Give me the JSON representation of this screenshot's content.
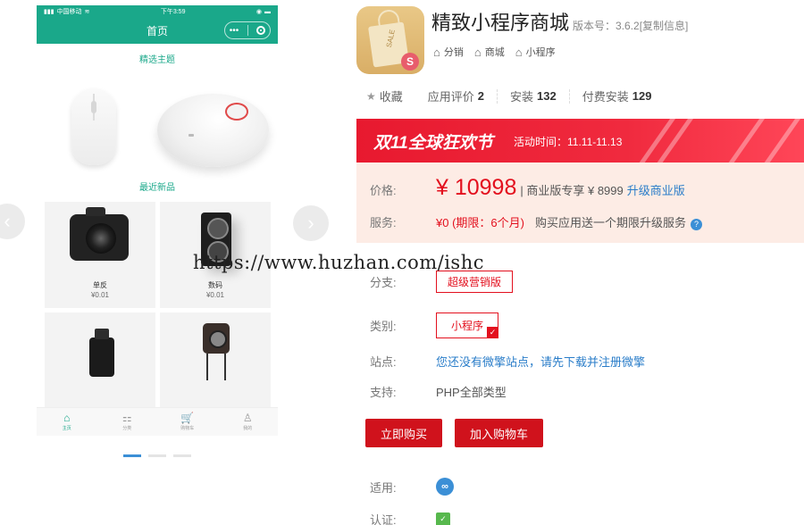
{
  "phone": {
    "status_left": "中国移动",
    "status_time": "下午3:59",
    "nav_title": "首页",
    "capsule_more": "•••",
    "featured_title": "精选主题",
    "new_title": "最近新品",
    "products": [
      {
        "name": "单反",
        "price": "¥0.01"
      },
      {
        "name": "数码",
        "price": "¥0.01"
      },
      {
        "name": "",
        "price": ""
      },
      {
        "name": "",
        "price": ""
      }
    ],
    "tabs": [
      {
        "label": "主页",
        "icon": "home-icon",
        "glyph": "⌂"
      },
      {
        "label": "分类",
        "icon": "grid-icon",
        "glyph": "⚏"
      },
      {
        "label": "购物车",
        "icon": "cart-icon",
        "glyph": "🛒"
      },
      {
        "label": "我的",
        "icon": "user-icon",
        "glyph": "♙"
      }
    ],
    "accent": "#1aa88a"
  },
  "carousel": {
    "prev_glyph": "‹",
    "next_glyph": "›"
  },
  "app": {
    "title": "精致小程序商城",
    "version": "版本号：3.6.2[复制信息]",
    "icon_text": "SALE",
    "icon_badge": "S",
    "tags": [
      "分销",
      "商城",
      "小程序"
    ]
  },
  "stats": {
    "favorite": "收藏",
    "rating_label": "应用评价",
    "rating_value": "2",
    "install_label": "安装",
    "install_value": "132",
    "paid_label": "付费安装",
    "paid_value": "129"
  },
  "promo": {
    "title": "双11全球狂欢节",
    "time": "活动时间：11.11-11.13"
  },
  "pricing": {
    "price_label": "价格:",
    "price": "¥ 10998",
    "price_extra": "| 商业版专享 ¥ 8999",
    "upgrade": "升级商业版",
    "service_label": "服务:",
    "service_free": "¥0 (期限：6个月)",
    "service_text": "购买应用送一个期限升级服务"
  },
  "watermark": "https://www.huzhan.com/ishc",
  "details": {
    "branch_label": "分支:",
    "branch_value": "超级营销版",
    "category_label": "类别:",
    "category_value": "小程序",
    "site_label": "站点:",
    "site_value": "您还没有微擎站点，请先下载并注册微擎",
    "support_label": "支持:",
    "support_value": "PHP全部类型",
    "applicable_label": "适用:",
    "cert_label": "认证:"
  },
  "actions": {
    "buy_now": "立即购买",
    "add_cart": "加入购物车"
  },
  "colors": {
    "brand_red": "#d0121c",
    "link_blue": "#2a7dc9",
    "price_bg": "#fdece5"
  }
}
